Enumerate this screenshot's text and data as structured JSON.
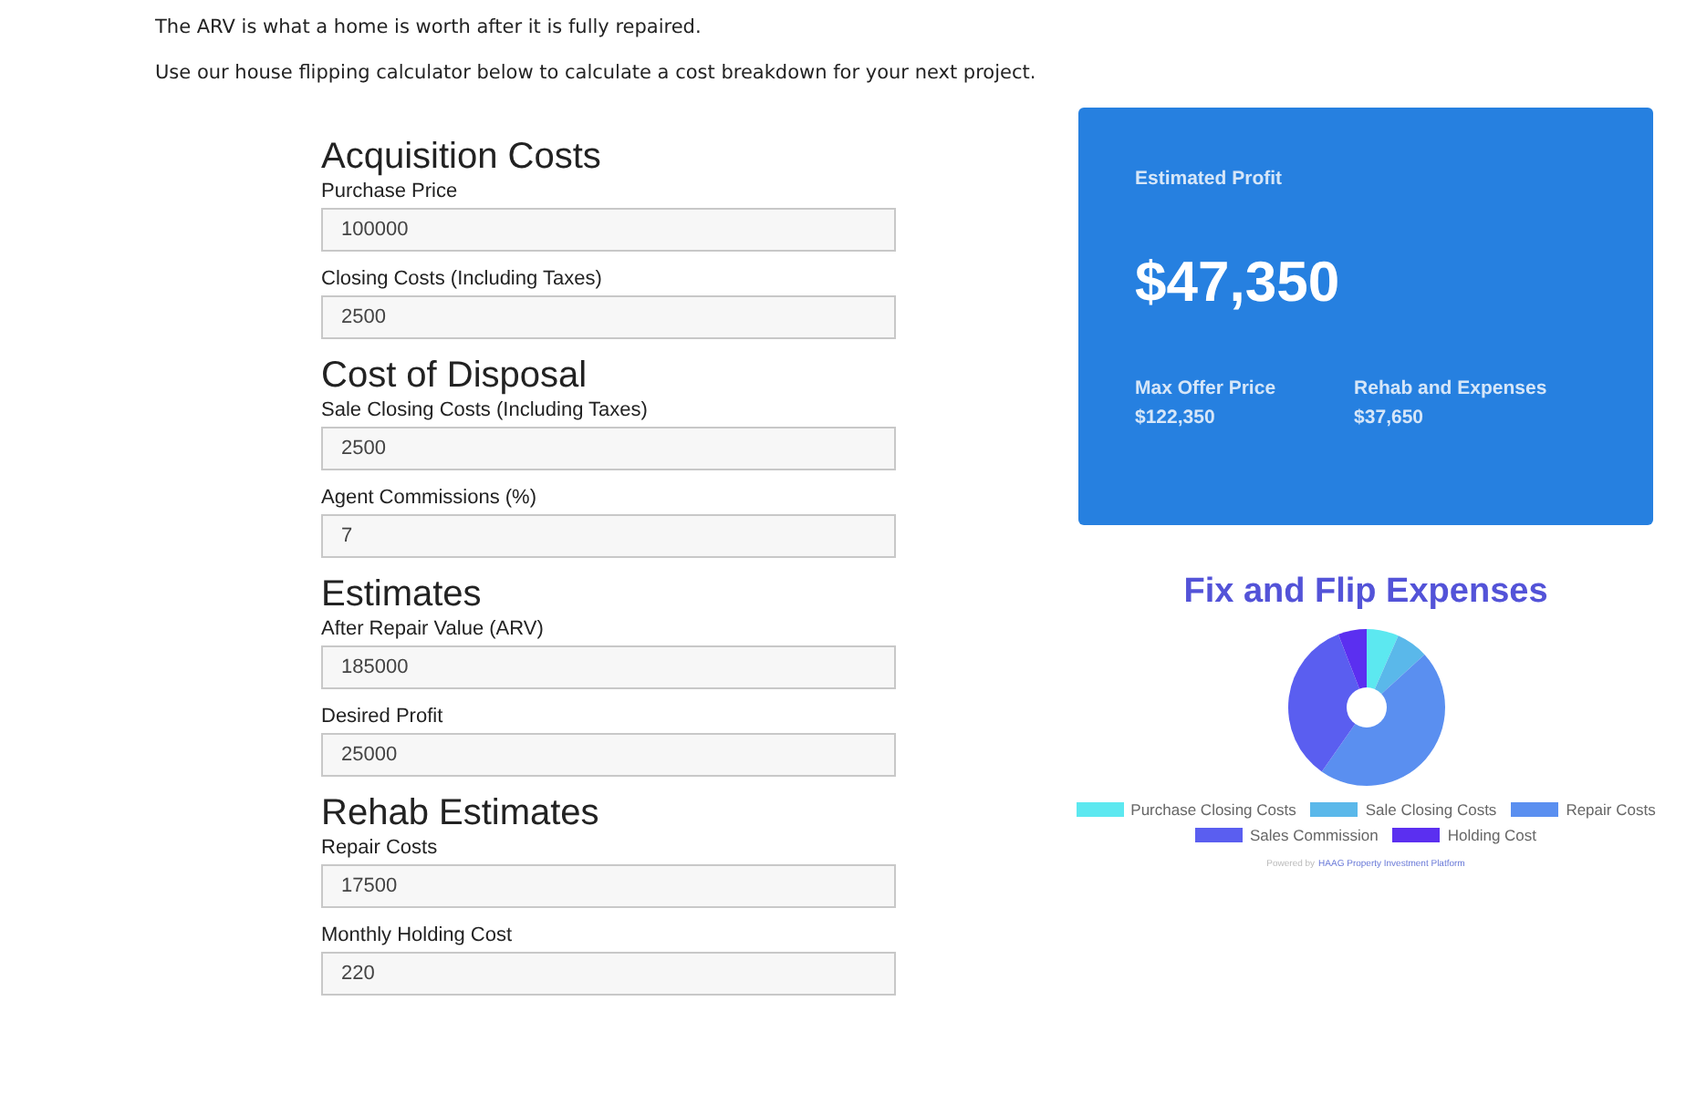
{
  "intro": [
    "The ARV is what a home is worth after it is fully repaired.",
    "Use our house flipping calculator below to calculate a cost breakdown for your next project."
  ],
  "sections": [
    {
      "title": "Acquisition Costs",
      "fields": [
        {
          "label": "Purchase Price",
          "value": "100000"
        },
        {
          "label": "Closing Costs (Including Taxes)",
          "value": "2500"
        }
      ]
    },
    {
      "title": "Cost of Disposal",
      "fields": [
        {
          "label": "Sale Closing Costs (Including Taxes)",
          "value": "2500"
        },
        {
          "label": "Agent Commissions (%)",
          "value": "7"
        }
      ]
    },
    {
      "title": "Estimates",
      "fields": [
        {
          "label": "After Repair Value (ARV)",
          "value": "185000"
        },
        {
          "label": "Desired Profit",
          "value": "25000"
        }
      ]
    },
    {
      "title": "Rehab Estimates",
      "fields": [
        {
          "label": "Repair Costs",
          "value": "17500"
        },
        {
          "label": "Monthly Holding Cost",
          "value": "220"
        }
      ]
    }
  ],
  "summary": {
    "label": "Estimated Profit",
    "value": "$47,350",
    "stats": [
      {
        "label": "Max Offer Price",
        "value": "$122,350"
      },
      {
        "label": "Rehab and Expenses",
        "value": "$37,650"
      }
    ]
  },
  "chart": {
    "title": "Fix and Flip Expenses",
    "kind": "donut",
    "legend": [
      {
        "label": "Purchase Closing Costs",
        "color": "#5ce8f0"
      },
      {
        "label": "Sale Closing Costs",
        "color": "#5ab8ea"
      },
      {
        "label": "Repair Costs",
        "color": "#5a8ff0"
      },
      {
        "label": "Sales Commission",
        "color": "#5a5ef0"
      },
      {
        "label": "Holding Cost",
        "color": "#5b2ff0"
      }
    ]
  },
  "footer": {
    "prefix": "Powered by",
    "link": "HAAG Property Investment Platform"
  }
}
